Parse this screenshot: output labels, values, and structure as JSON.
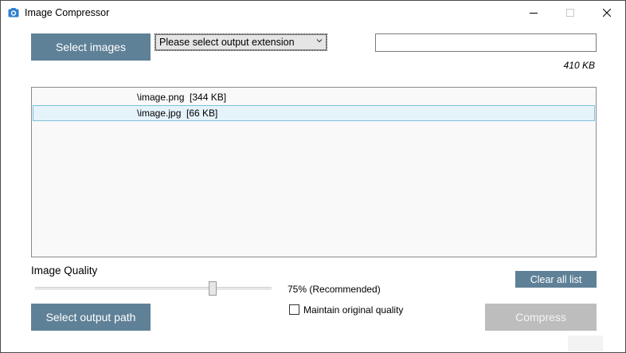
{
  "window": {
    "title": "Image Compressor",
    "icon": "camera-icon"
  },
  "controls": {
    "minimize": "minimize-icon",
    "maximize": "maximize-icon",
    "close": "close-icon"
  },
  "toolbar": {
    "select_images_label": "Select images",
    "extension_select": {
      "selected": "Please select output extension"
    },
    "size_input_value": "",
    "total_size": "410 KB"
  },
  "file_list": {
    "items": [
      {
        "label": "\\image.png  [344 KB]",
        "selected": false
      },
      {
        "label": "\\image.jpg  [66 KB]",
        "selected": true
      }
    ]
  },
  "quality": {
    "label": "Image Quality",
    "value_percent": 75,
    "value_text": "75% (Recommended)"
  },
  "actions": {
    "clear_label": "Clear all list",
    "select_output_label": "Select output path",
    "maintain_label": "Maintain original quality",
    "maintain_checked": false,
    "compress_label": "Compress",
    "compress_enabled": false
  },
  "colors": {
    "primary_button": "#5f8197",
    "disabled_button": "#bdbdbd",
    "selection_bg": "#e5f3fb",
    "selection_border": "#7fbfdc"
  }
}
